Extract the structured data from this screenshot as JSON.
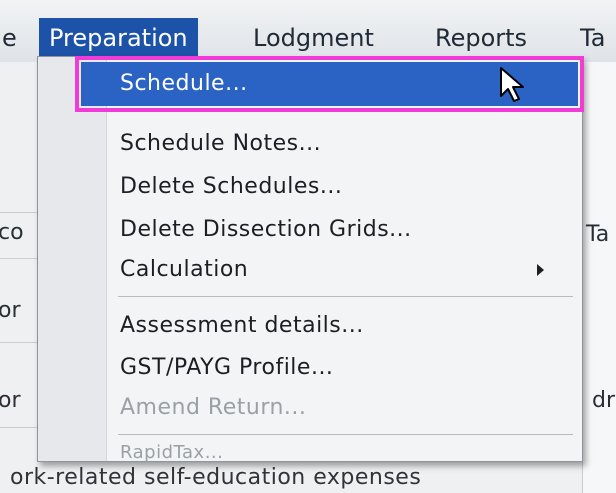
{
  "menubar": {
    "items": [
      {
        "label": "e"
      },
      {
        "label": "Preparation"
      },
      {
        "label": "Lodgment"
      },
      {
        "label": "Reports"
      },
      {
        "label": "Ta"
      }
    ]
  },
  "background": {
    "left_labels": [
      "co",
      "or",
      "or"
    ],
    "right_labels": [
      "Ta",
      "dr"
    ],
    "bottom_text": "ork-related self-education expenses"
  },
  "menu": {
    "items": [
      {
        "label": "Schedule..."
      },
      {
        "label": "Schedule Notes..."
      },
      {
        "label": "Delete Schedules..."
      },
      {
        "label": "Delete Dissection Grids..."
      },
      {
        "label": "Calculation"
      },
      {
        "label": "Assessment details..."
      },
      {
        "label": "GST/PAYG Profile..."
      },
      {
        "label": "Amend Return..."
      },
      {
        "label": "RapidTax..."
      }
    ]
  },
  "colors": {
    "menubar_active": "#1c52a8",
    "selection": "#2a63c4",
    "highlight_outline": "#f23ad6"
  }
}
